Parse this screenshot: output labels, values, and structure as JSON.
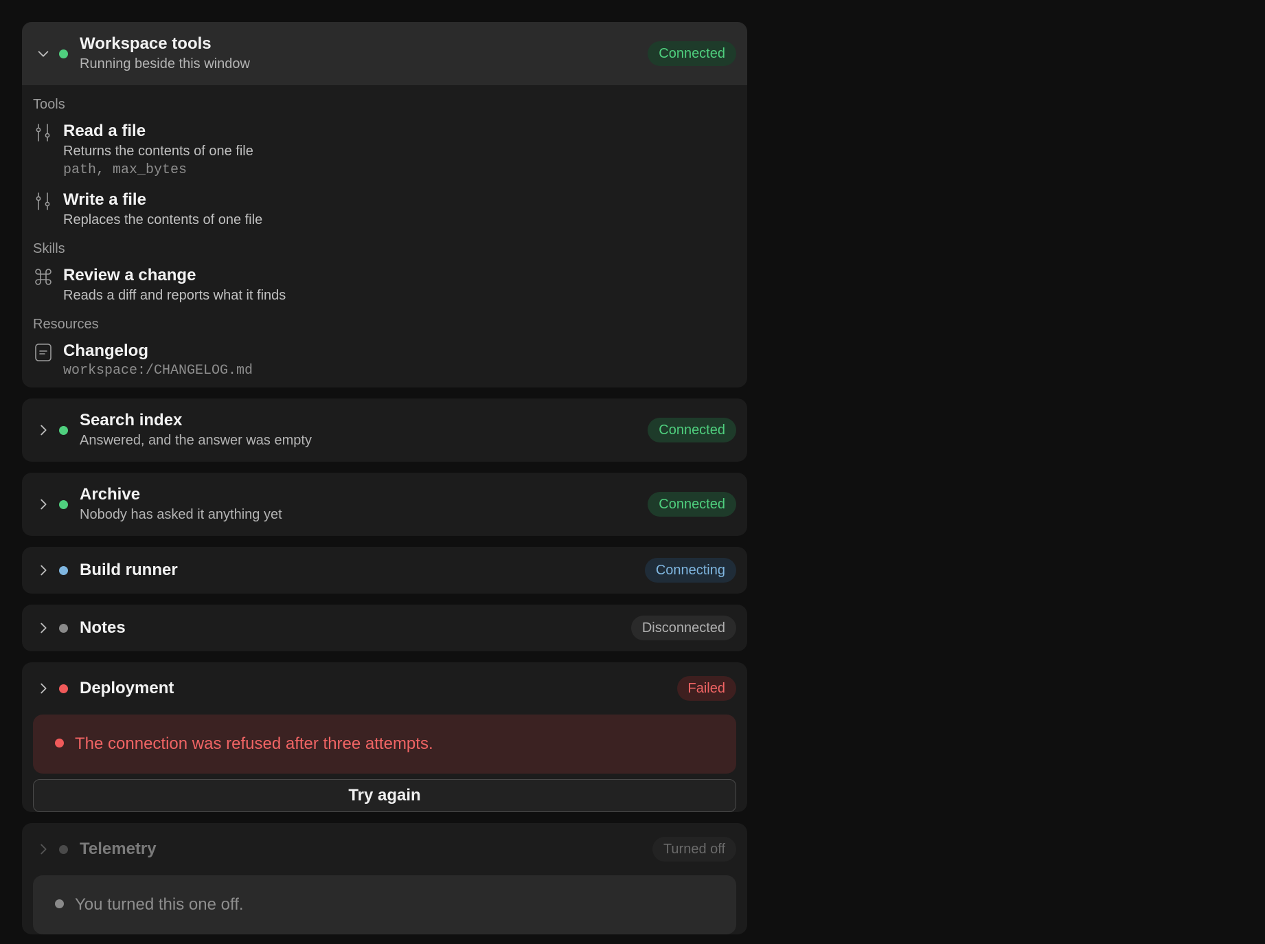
{
  "servers": [
    {
      "title": "Workspace tools",
      "subtitle": "Running beside this window",
      "status": "Connected"
    },
    {
      "title": "Search index",
      "subtitle": "Answered, and the answer was empty",
      "status": "Connected"
    },
    {
      "title": "Archive",
      "subtitle": "Nobody has asked it anything yet",
      "status": "Connected"
    },
    {
      "title": "Build runner",
      "status": "Connecting"
    },
    {
      "title": "Notes",
      "status": "Disconnected"
    },
    {
      "title": "Deployment",
      "status": "Failed",
      "error": "The connection was refused after three attempts.",
      "retry_label": "Try again"
    },
    {
      "title": "Telemetry",
      "status": "Turned off",
      "note": "You turned this one off."
    }
  ],
  "workspace": {
    "tools_label": "Tools",
    "tools": [
      {
        "title": "Read a file",
        "desc": "Returns the contents of one file",
        "params": "path, max_bytes",
        "icon": "sliders-icon"
      },
      {
        "title": "Write a file",
        "desc": "Replaces the contents of one file",
        "icon": "sliders-icon"
      }
    ],
    "skills_label": "Skills",
    "skills": [
      {
        "title": "Review a change",
        "desc": "Reads a diff and reports what it finds",
        "icon": "command-icon"
      }
    ],
    "resources_label": "Resources",
    "resources": [
      {
        "title": "Changelog",
        "uri": "workspace:/CHANGELOG.md",
        "icon": "document-icon"
      }
    ]
  },
  "colors": {
    "connected": "#4fcf7e",
    "connecting": "#7fb6e0",
    "disconnected": "#8a8a8a",
    "failed": "#f05a5a",
    "off": "#4a4a4a"
  }
}
